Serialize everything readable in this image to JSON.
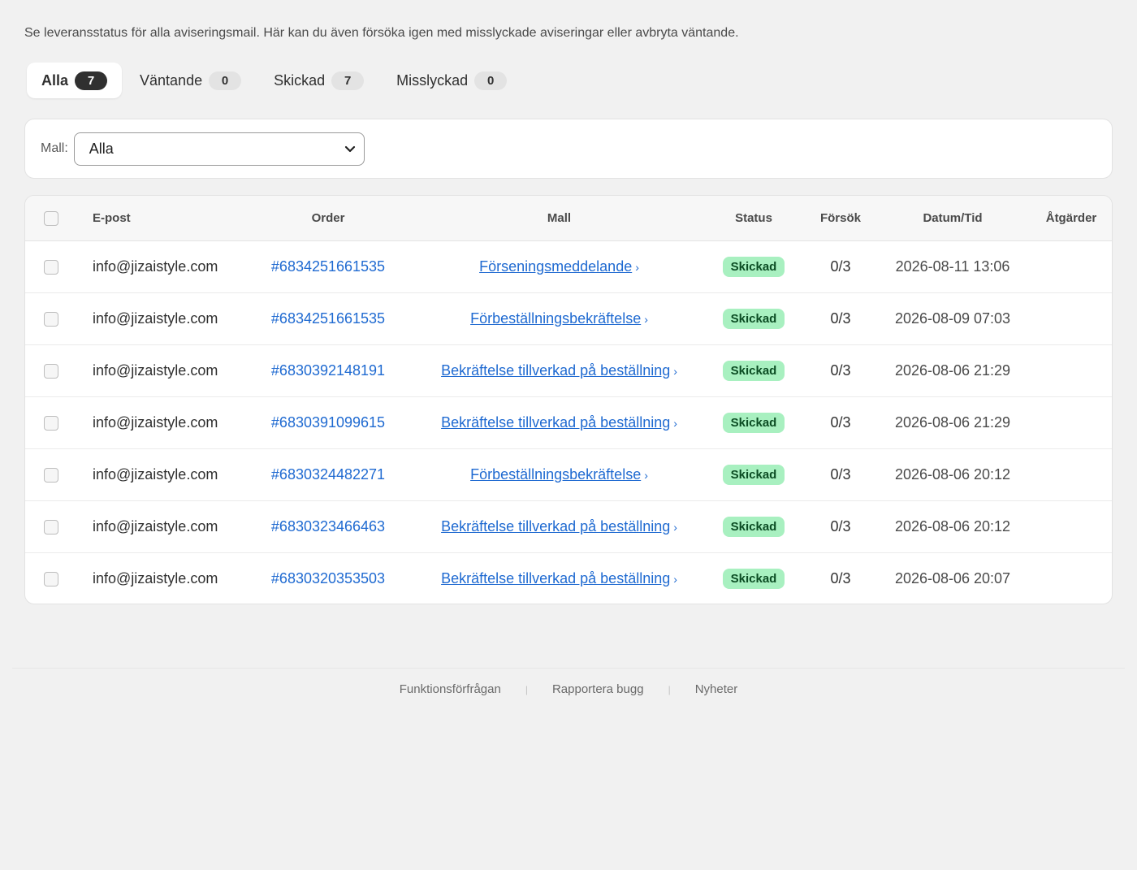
{
  "intro": "Se leveransstatus för alla aviseringsmail. Här kan du även försöka igen med misslyckade aviseringar eller avbryta väntande.",
  "tabs": [
    {
      "label": "Alla",
      "count": "7"
    },
    {
      "label": "Väntande",
      "count": "0"
    },
    {
      "label": "Skickad",
      "count": "7"
    },
    {
      "label": "Misslyckad",
      "count": "0"
    }
  ],
  "filter": {
    "label": "Mall:",
    "selected": "Alla"
  },
  "table": {
    "headers": {
      "email": "E-post",
      "order": "Order",
      "template": "Mall",
      "status": "Status",
      "tries": "Försök",
      "datetime": "Datum/Tid",
      "actions": "Åtgärder"
    },
    "rows": [
      {
        "email": "info@jizaistyle.com",
        "order": "#6834251661535",
        "template": "Förseningsmeddelande",
        "status": "Skickad",
        "tries": "0/3",
        "datetime": "2026-08-11 13:06"
      },
      {
        "email": "info@jizaistyle.com",
        "order": "#6834251661535",
        "template": "Förbeställningsbekräftelse",
        "status": "Skickad",
        "tries": "0/3",
        "datetime": "2026-08-09 07:03"
      },
      {
        "email": "info@jizaistyle.com",
        "order": "#6830392148191",
        "template": "Bekräftelse tillverkad på beställning",
        "status": "Skickad",
        "tries": "0/3",
        "datetime": "2026-08-06 21:29"
      },
      {
        "email": "info@jizaistyle.com",
        "order": "#6830391099615",
        "template": "Bekräftelse tillverkad på beställning",
        "status": "Skickad",
        "tries": "0/3",
        "datetime": "2026-08-06 21:29"
      },
      {
        "email": "info@jizaistyle.com",
        "order": "#6830324482271",
        "template": "Förbeställningsbekräftelse",
        "status": "Skickad",
        "tries": "0/3",
        "datetime": "2026-08-06 20:12"
      },
      {
        "email": "info@jizaistyle.com",
        "order": "#6830323466463",
        "template": "Bekräftelse tillverkad på beställning",
        "status": "Skickad",
        "tries": "0/3",
        "datetime": "2026-08-06 20:12"
      },
      {
        "email": "info@jizaistyle.com",
        "order": "#6830320353503",
        "template": "Bekräftelse tillverkad på beställning",
        "status": "Skickad",
        "tries": "0/3",
        "datetime": "2026-08-06 20:07"
      }
    ]
  },
  "footer": {
    "links": [
      "Funktionsförfrågan",
      "Rapportera bugg",
      "Nyheter"
    ],
    "separator": "|"
  },
  "colors": {
    "link": "#1f6ad1",
    "status_bg": "#a8f0c0",
    "status_text": "#0b4c23",
    "active_badge": "#303030"
  },
  "icons": {
    "select": "chevron-down-icon",
    "template_link": "chevron-right-icon"
  },
  "glyphs": {
    "chevron_right": "›"
  }
}
